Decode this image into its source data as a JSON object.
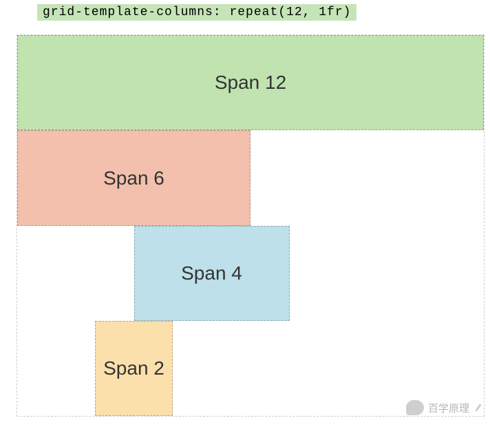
{
  "code_strip": "grid-template-columns: repeat(12, 1fr)",
  "cells": {
    "span12": "Span 12",
    "span6": "Span 6",
    "span4": "Span 4",
    "span2": "Span 2"
  },
  "watermark": {
    "label": "百学原理"
  }
}
